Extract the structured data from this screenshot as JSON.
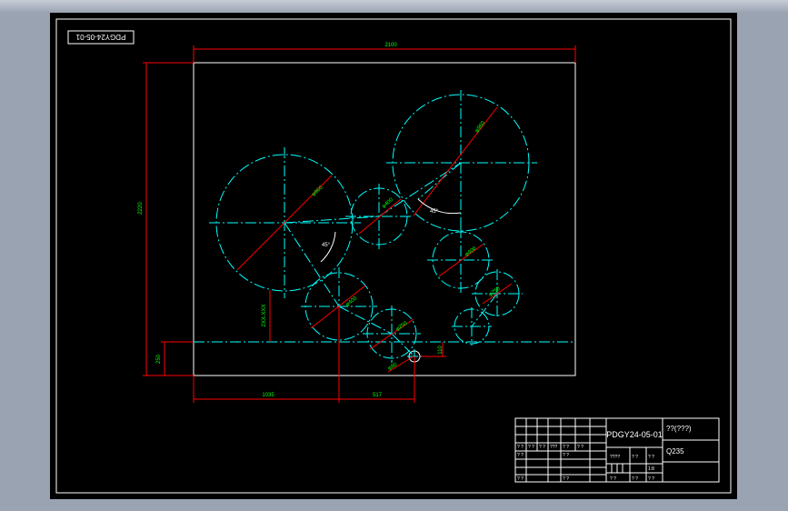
{
  "drawing": {
    "rotated_id": "PDGY24-05-01",
    "dim_width": "2100",
    "dim_height": "2220",
    "dim_left_offset": "1035",
    "dim_gap": "517",
    "dim_v1": "2XX.XXX",
    "dim_base": "250",
    "dim_small": "110",
    "dia1": "φ960",
    "dia2": "φ960",
    "dia3": "φ400",
    "dia4": "φ400",
    "dia5": "φ400",
    "dia6": "φ250",
    "dia7": "φ250",
    "dia8": "φ80",
    "angle1": "45°",
    "angle2": "45°"
  },
  "titleblock": {
    "code": "PDGY24-05-01",
    "name": "??(???)",
    "material": "Q235",
    "cells": [
      "? ?",
      "? ?",
      "? ?",
      "???",
      "? ?",
      "? ?",
      "? ?",
      "? ?",
      "????",
      "? ?",
      "? ?",
      "1:8",
      "? ?",
      "? ?",
      "? ?",
      "? ?",
      "? ?"
    ]
  }
}
